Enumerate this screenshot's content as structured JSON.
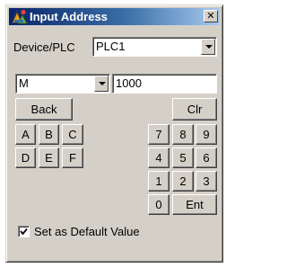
{
  "window": {
    "title": "Input Address",
    "close_label": "✕"
  },
  "device": {
    "label": "Device/PLC",
    "value": "PLC1"
  },
  "address": {
    "type_value": "M",
    "number_value": "1000"
  },
  "keypad": {
    "back": "Back",
    "clr": "Clr",
    "hex": [
      "A",
      "B",
      "C",
      "D",
      "E",
      "F"
    ],
    "digits": [
      "7",
      "8",
      "9",
      "4",
      "5",
      "6",
      "1",
      "2",
      "3",
      "0"
    ],
    "ent": "Ent"
  },
  "default_value": {
    "label": "Set as Default Value",
    "checked": true
  }
}
